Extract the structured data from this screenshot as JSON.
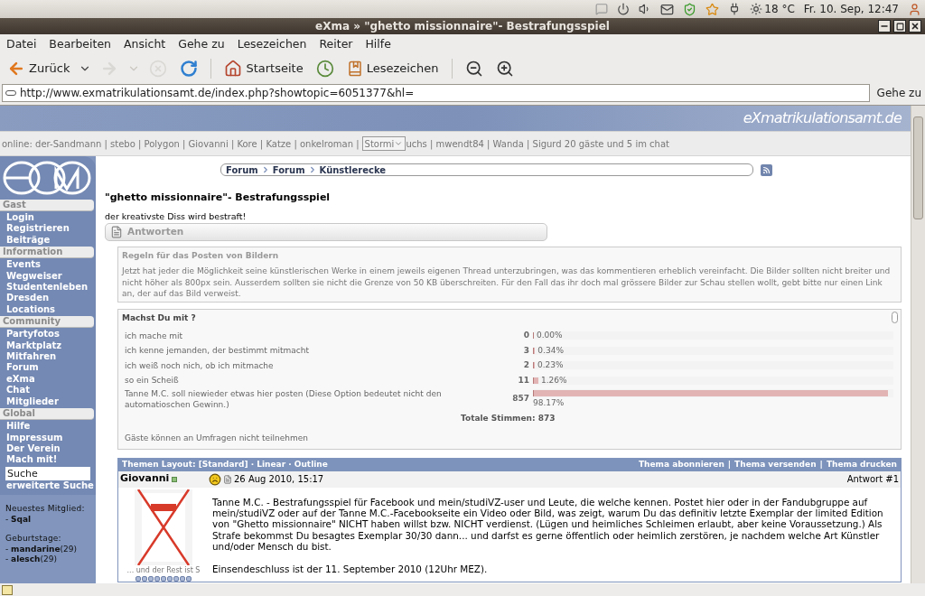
{
  "top_panel": {
    "weather": "18 °C",
    "clock": "Fr. 10. Sep, 12:47"
  },
  "window": {
    "title": "eXma » \"ghetto missionnaire\"- Bestrafungsspiel"
  },
  "menu": [
    "Datei",
    "Bearbeiten",
    "Ansicht",
    "Gehe zu",
    "Lesezeichen",
    "Reiter",
    "Hilfe"
  ],
  "toolbar": [
    {
      "kind": "back",
      "label": "Zurück",
      "disabled": false
    },
    {
      "kind": "forward",
      "disabled": true
    },
    {
      "kind": "stop",
      "disabled": true
    },
    {
      "kind": "reload",
      "disabled": false
    },
    {
      "kind": "home",
      "label": "Startseite",
      "disabled": false
    },
    {
      "kind": "history",
      "disabled": false
    },
    {
      "kind": "bookmarks",
      "label": "Lesezeichen",
      "disabled": false
    },
    {
      "kind": "zoom_out",
      "disabled": false
    },
    {
      "kind": "zoom_in",
      "disabled": false
    }
  ],
  "address_bar": {
    "url": "http://www.exmatrikulationsamt.de/index.php?showtopic=6051377&hl=",
    "go": "Gehe zu"
  },
  "site": {
    "banner": "eXmatrikulationsamt.de",
    "online_bar": {
      "before": "online: der-Sandmann | stebo | Polygon | Giovanni | Kore | Katze | onkelroman |",
      "dropdown": "Stormi",
      "after": "uchs | mwendt84 | Wanda | Sigurd 20 gäste und 5 im chat"
    }
  },
  "sidebar": {
    "sections": [
      {
        "title": "Gast",
        "items": [
          "Login",
          "Registrieren",
          "Beiträge"
        ]
      },
      {
        "title": "Information",
        "items": [
          "Events",
          "Wegweiser",
          "Studentenleben",
          "Dresden",
          "Locations"
        ]
      },
      {
        "title": "Community",
        "items": [
          "Partyfotos",
          "Marktplatz",
          "Mitfahren",
          "Forum",
          "eXma",
          "Chat",
          "Mitglieder"
        ]
      },
      {
        "title": "Global",
        "items": [
          "Hilfe",
          "Impressum",
          "Der Verein",
          "Mach mit!"
        ]
      }
    ],
    "search": {
      "value": "Suche"
    },
    "advanced_search": "erweiterte Suche",
    "info": [
      {
        "label": "Neuestes Mitglied:",
        "items": [
          "- **Sqal**"
        ]
      },
      {
        "label": "Geburtstage:",
        "items": [
          "- **mandarine**(29)",
          "- **alesch**(29)"
        ]
      }
    ]
  },
  "breadcrumb": [
    "Forum",
    "Forum",
    "Künstlerecke"
  ],
  "thread": {
    "title": "\"ghetto missionnaire\"- Bestrafungsspiel",
    "description": "der kreativste Diss wird bestraft!",
    "reply_button": "Antworten"
  },
  "rules": {
    "title": "Regeln für das Posten von Bildern",
    "text": "Jetzt hat jeder die Möglichkeit seine künstlerischen Werke in einem jeweils eigenen Thread unterzubringen, was das kommentieren erheblich vereinfacht. Die Bilder sollten nicht breiter und nicht höher als 800px sein. Ausserdem sollten sie nicht die Grenze von 50 KB überschreiten. Für den Fall das ihr doch mal grössere Bilder zur Schau stellen wollt, gebt bitte nur einen Link an, der auf das Bild verweist."
  },
  "poll": {
    "question": "Machst Du mit ?",
    "options": [
      {
        "label": "ich mache mit",
        "votes": "0",
        "percent": "0.00%",
        "level": 0
      },
      {
        "label": "ich kenne jemanden, der bestimmt mitmacht",
        "votes": "3",
        "percent": "0.34%",
        "level": 0.0034
      },
      {
        "label": "ich weiß noch nich, ob ich mitmache",
        "votes": "2",
        "percent": "0.23%",
        "level": 0.0023
      },
      {
        "label": "so ein Scheiß",
        "votes": "11",
        "percent": "1.26%",
        "level": 0.0126
      },
      {
        "label": "Tanne M.C. soll niewieder etwas hier posten (Diese Option bedeutet nicht den automatioschen Gewinn.)",
        "votes": "857",
        "percent": "98.17%",
        "level": 0.9817
      }
    ],
    "total": "Totale Stimmen: 873",
    "note": "Gäste können an Umfragen nicht teilnehmen"
  },
  "topic_bar": {
    "layout": "Themen Layout: [Standard] · Linear · Outline",
    "separator": "|",
    "actions": [
      "Thema abonnieren",
      "Thema versenden",
      "Thema drucken"
    ]
  },
  "posts": [
    {
      "author": "Giovanni",
      "online": true,
      "date": "26 Aug 2010, 15:17",
      "number": "Antwort #1",
      "caption": "... und der Rest ist S",
      "paragraphs": [
        "Tanne M.C. - Bestrafungsspiel für Facebook und mein/studiVZ-user und Leute, die welche kennen. Postet hier oder in der Fandubgruppe auf mein/studiVZ oder auf der Tanne M.C.-Facebookseite ein Video oder Bild, was zeigt, warum Du das definitiv letzte Exemplar der limited Edition von \"Ghetto missionnaire\" NICHT haben willst bzw. NICHT verdienst. (Lügen und heimliches Schleimen erlaubt, aber keine Voraussetzung.) Als Strafe bekommst Du besagtes Exemplar 30/30 dann... und darfst es gerne öffentlich oder heimlich zerstören, je nachdem welche Art Künstler und/oder Mensch du bist.",
        "Einsendeschluss ist der 11. September 2010 (12Uhr MEZ)."
      ]
    }
  ]
}
